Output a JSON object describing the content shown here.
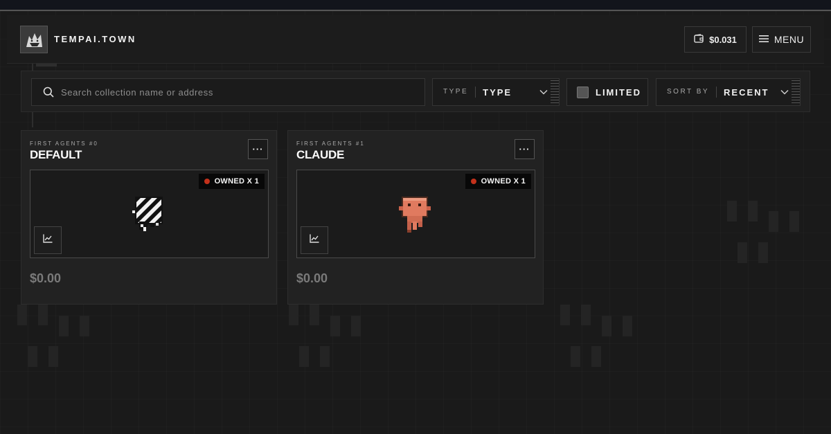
{
  "header": {
    "brand": "TEMPAI.TOWN",
    "logo_icon": "wolf-logo-icon",
    "wallet": {
      "icon": "wallet-icon",
      "balance": "$0.031"
    },
    "menu": {
      "icon": "hamburger-icon",
      "label": "MENU"
    }
  },
  "filters": {
    "search": {
      "placeholder": "Search collection name or address",
      "value": "",
      "icon": "search-icon"
    },
    "type": {
      "label": "TYPE",
      "value": "TYPE",
      "icon": "chevron-down-icon"
    },
    "limited": {
      "label": "LIMITED",
      "checked": false
    },
    "sort": {
      "label": "SORT BY",
      "value": "RECENT",
      "icon": "chevron-down-icon"
    }
  },
  "cards": [
    {
      "subtitle": "FIRST AGENTS #0",
      "title": "DEFAULT",
      "more_label": "···",
      "badge": "OWNED X 1",
      "price": "$0.00",
      "sprite_icon": "striped-agent-icon",
      "chart_icon": "line-chart-icon"
    },
    {
      "subtitle": "FIRST AGENTS #1",
      "title": "CLAUDE",
      "more_label": "···",
      "badge": "OWNED X 1",
      "price": "$0.00",
      "sprite_icon": "orange-agent-icon",
      "chart_icon": "line-chart-icon"
    }
  ],
  "colors": {
    "background": "#1a1a1a",
    "panel": "#222222",
    "accent_red": "#c3311b",
    "claude_orange": "#e07a5f"
  }
}
